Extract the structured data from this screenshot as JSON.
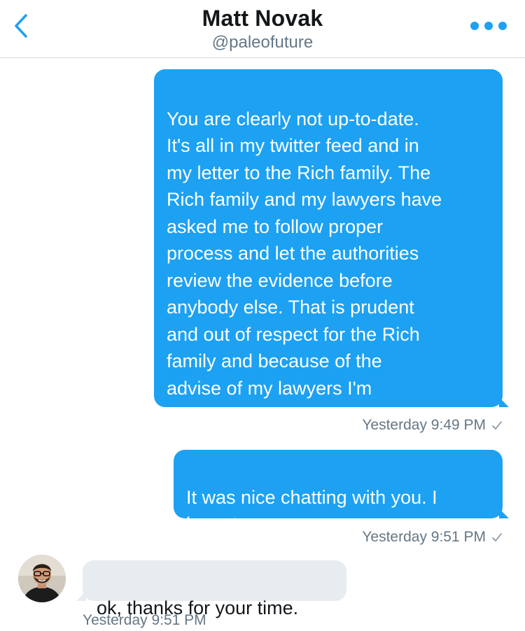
{
  "header": {
    "title": "Matt Novak",
    "handle": "@paleofuture",
    "back_icon": "chevron-left-icon",
    "more_icon": "more-horizontal-icon",
    "accent_color": "#1da1f2"
  },
  "messages": [
    {
      "direction": "sent",
      "text": "You are clearly not up-to-date.\nIt's all in my twitter feed and in\nmy letter to the Rich family. The\nRich family and my lawyers have\nasked me to follow proper\nprocess and let the authorities\nreview the evidence before\nanybody else. That is prudent\nand out of respect for the Rich\nfamily and because of the\nadvise of my lawyers I'm\nfollowing that path.",
      "timestamp": "Yesterday 9:49 PM",
      "status_icon": "checkmark-icon"
    },
    {
      "direction": "sent",
      "text": "It was nice chatting with you. I\nhave to go now.",
      "timestamp": "Yesterday 9:51 PM",
      "status_icon": "checkmark-icon"
    },
    {
      "direction": "received",
      "text": "ok, thanks for your time.",
      "timestamp": "Yesterday 9:51 PM",
      "avatar_icon": "avatar"
    }
  ],
  "colors": {
    "sent_bubble": "#1da1f2",
    "received_bubble": "#e6ecf0",
    "meta_text": "#657786"
  }
}
